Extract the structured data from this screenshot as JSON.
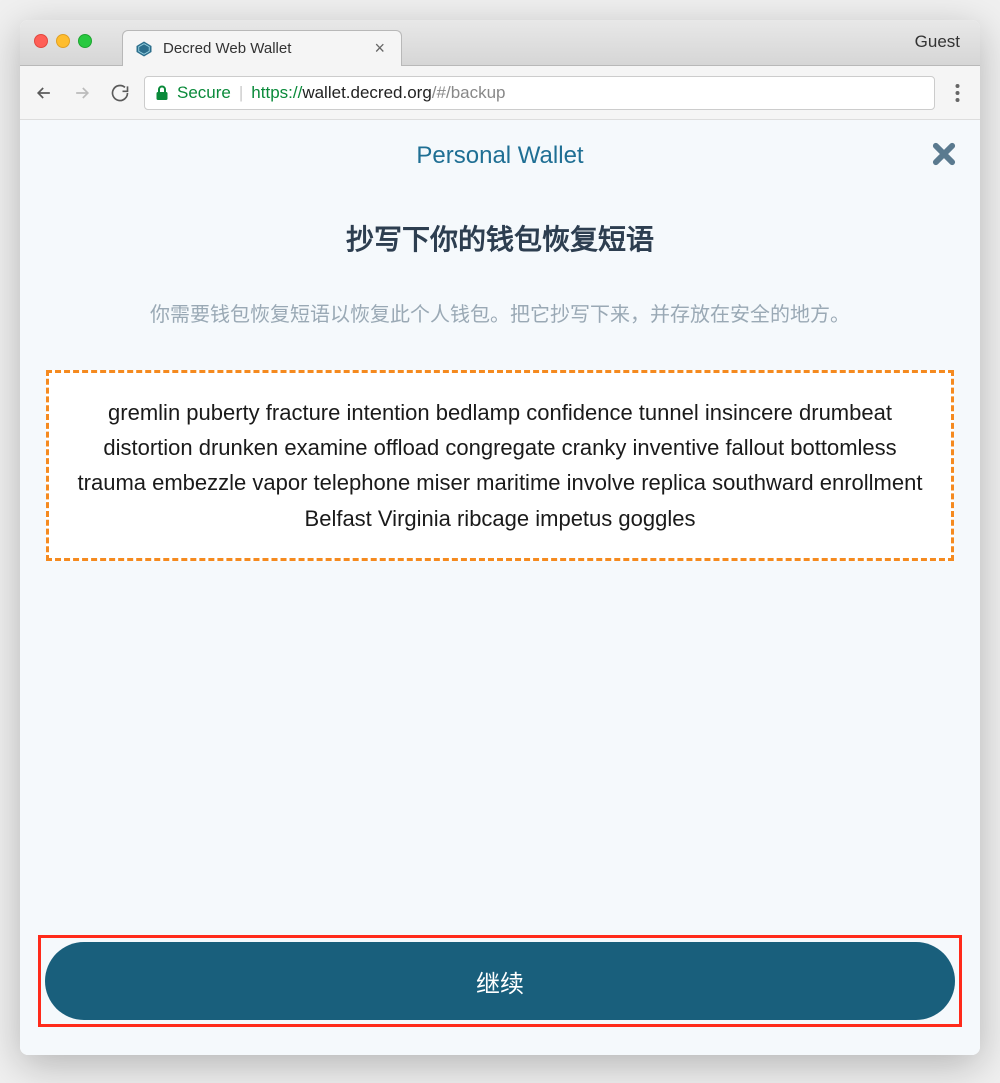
{
  "browser": {
    "tab_title": "Decred Web Wallet",
    "guest_label": "Guest",
    "secure_label": "Secure",
    "url_protocol": "https://",
    "url_host": "wallet.decred.org",
    "url_path": "/#/backup"
  },
  "page": {
    "wallet_title": "Personal Wallet",
    "heading": "抄写下你的钱包恢复短语",
    "instructions": "你需要钱包恢复短语以恢复此个人钱包。把它抄写下来，并存放在安全的地方。",
    "seed_phrase": "gremlin puberty fracture intention bedlamp confidence tunnel insincere drumbeat distortion drunken examine offload congregate cranky inventive fallout bottomless trauma embezzle vapor telephone miser maritime involve replica southward enrollment Belfast Virginia ribcage impetus goggles",
    "continue_label": "继续"
  }
}
